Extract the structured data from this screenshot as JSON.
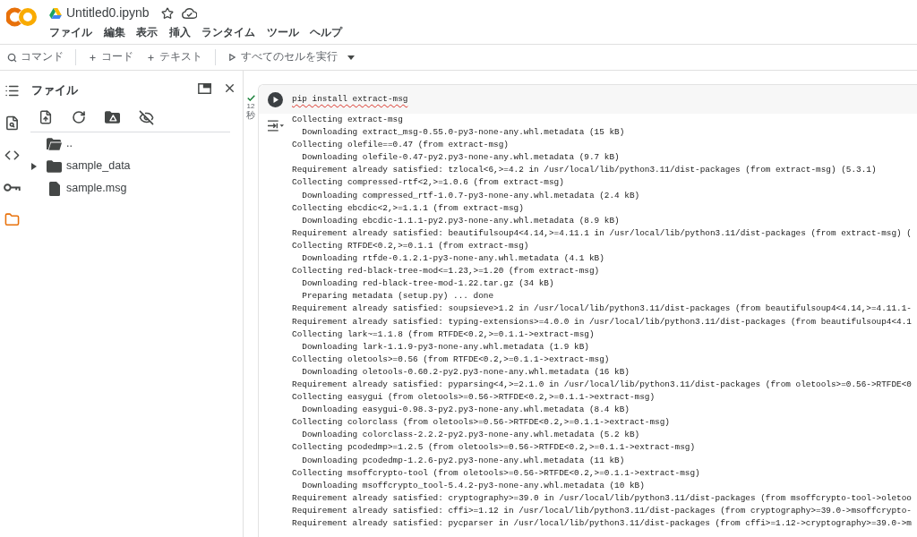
{
  "header": {
    "title": "Untitled0.ipynb",
    "starred": false
  },
  "menu": [
    "ファイル",
    "編集",
    "表示",
    "挿入",
    "ランタイム",
    "ツール",
    "ヘルプ"
  ],
  "toolbar": {
    "command": "コマンド",
    "add_buttons": [
      "コード",
      "テキスト"
    ],
    "run_all": "すべてのセルを実行"
  },
  "rail": [
    {
      "kind": "toc",
      "selected": false
    },
    {
      "kind": "search",
      "selected": false
    },
    {
      "kind": "snippets",
      "selected": false
    },
    {
      "kind": "secrets",
      "selected": false
    },
    {
      "kind": "files",
      "selected": true
    }
  ],
  "file_panel": {
    "title": "ファイル",
    "items": [
      {
        "kind": "parent",
        "name": ".."
      },
      {
        "kind": "folder",
        "name": "sample_data",
        "expanded": false
      },
      {
        "kind": "file",
        "name": "sample.msg"
      }
    ]
  },
  "cell": {
    "succeeded": true,
    "elapsed": "12",
    "unit": "秒",
    "code": "pip install extract-msg",
    "spell_flagged": true,
    "output": [
      "Collecting extract-msg",
      "  Downloading extract_msg-0.55.0-py3-none-any.whl.metadata (15 kB)",
      "Collecting olefile==0.47 (from extract-msg)",
      "  Downloading olefile-0.47-py2.py3-none-any.whl.metadata (9.7 kB)",
      "Requirement already satisfied: tzlocal<6,>=4.2 in /usr/local/lib/python3.11/dist-packages (from extract-msg) (5.3.1)",
      "Collecting compressed-rtf<2,>=1.0.6 (from extract-msg)",
      "  Downloading compressed_rtf-1.0.7-py3-none-any.whl.metadata (2.4 kB)",
      "Collecting ebcdic<2,>=1.1.1 (from extract-msg)",
      "  Downloading ebcdic-1.1.1-py2.py3-none-any.whl.metadata (8.9 kB)",
      "Requirement already satisfied: beautifulsoup4<4.14,>=4.11.1 in /usr/local/lib/python3.11/dist-packages (from extract-msg) (",
      "Collecting RTFDE<0.2,>=0.1.1 (from extract-msg)",
      "  Downloading rtfde-0.1.2.1-py3-none-any.whl.metadata (4.1 kB)",
      "Collecting red-black-tree-mod<=1.23,>=1.20 (from extract-msg)",
      "  Downloading red-black-tree-mod-1.22.tar.gz (34 kB)",
      "  Preparing metadata (setup.py) ... done",
      "Requirement already satisfied: soupsieve>1.2 in /usr/local/lib/python3.11/dist-packages (from beautifulsoup4<4.14,>=4.11.1-",
      "Requirement already satisfied: typing-extensions>=4.0.0 in /usr/local/lib/python3.11/dist-packages (from beautifulsoup4<4.1",
      "Collecting lark~=1.1.8 (from RTFDE<0.2,>=0.1.1->extract-msg)",
      "  Downloading lark-1.1.9-py3-none-any.whl.metadata (1.9 kB)",
      "Collecting oletools>=0.56 (from RTFDE<0.2,>=0.1.1->extract-msg)",
      "  Downloading oletools-0.60.2-py2.py3-none-any.whl.metadata (16 kB)",
      "Requirement already satisfied: pyparsing<4,>=2.1.0 in /usr/local/lib/python3.11/dist-packages (from oletools>=0.56->RTFDE<0",
      "Collecting easygui (from oletools>=0.56->RTFDE<0.2,>=0.1.1->extract-msg)",
      "  Downloading easygui-0.98.3-py2.py3-none-any.whl.metadata (8.4 kB)",
      "Collecting colorclass (from oletools>=0.56->RTFDE<0.2,>=0.1.1->extract-msg)",
      "  Downloading colorclass-2.2.2-py2.py3-none-any.whl.metadata (5.2 kB)",
      "Collecting pcodedmp>=1.2.5 (from oletools>=0.56->RTFDE<0.2,>=0.1.1->extract-msg)",
      "  Downloading pcodedmp-1.2.6-py2.py3-none-any.whl.metadata (11 kB)",
      "Collecting msoffcrypto-tool (from oletools>=0.56->RTFDE<0.2,>=0.1.1->extract-msg)",
      "  Downloading msoffcrypto_tool-5.4.2-py3-none-any.whl.metadata (10 kB)",
      "Requirement already satisfied: cryptography>=39.0 in /usr/local/lib/python3.11/dist-packages (from msoffcrypto-tool->oletoo",
      "Requirement already satisfied: cffi>=1.12 in /usr/local/lib/python3.11/dist-packages (from cryptography>=39.0->msoffcrypto-",
      "Requirement already satisfied: pycparser in /usr/local/lib/python3.11/dist-packages (from cffi>=1.12->cryptography>=39.0->m"
    ]
  }
}
